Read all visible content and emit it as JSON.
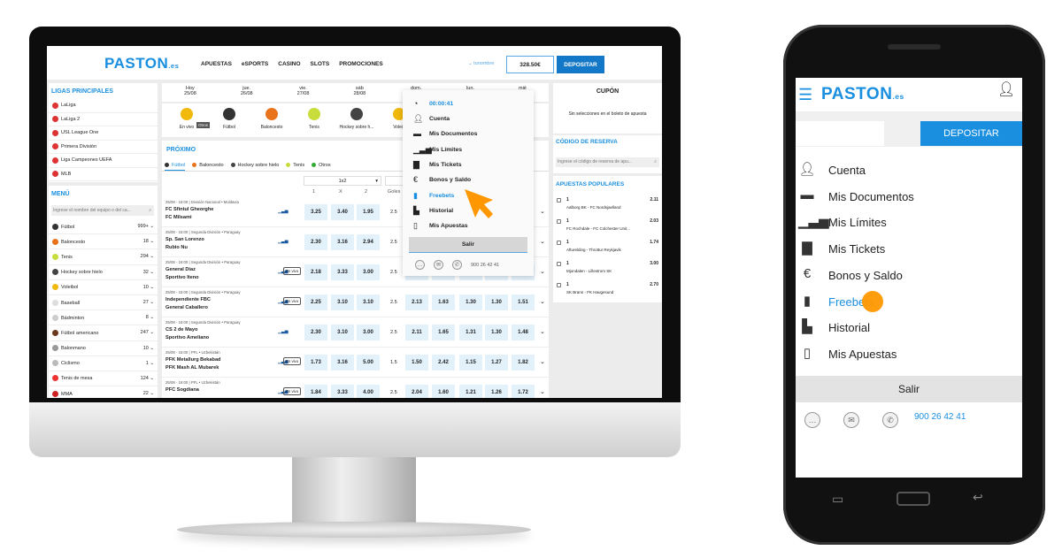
{
  "colors": {
    "brand": "#1a8fe0",
    "deposit": "#1478c8",
    "cursor": "#ff9800",
    "odds_bg": "#e3f1fb"
  },
  "desktop": {
    "logo": {
      "text": "PASTON",
      "suffix": ".es"
    },
    "nav": [
      "APUESTAS",
      "eSPORTS",
      "CASINO",
      "SLOTS",
      "PROMOCIONES"
    ],
    "user": "tunombre",
    "balance": "328.50€",
    "deposit": "DEPOSITAR",
    "leagues_title": "LIGAS PRINCIPALES",
    "leagues": [
      "LaLiga",
      "LaLiga 2",
      "USL League One",
      "Primera División",
      "Liga Campeones UEFA",
      "MLB"
    ],
    "menu_title": "MENÚ",
    "menu_search_placeholder": "Ingrese el nombre del equipo o del ca...",
    "sports": [
      {
        "name": "Fútbol",
        "count": "999+",
        "color": "#333"
      },
      {
        "name": "Baloncesto",
        "count": "18",
        "color": "#e8731a"
      },
      {
        "name": "Tenis",
        "count": "294",
        "color": "#c8dc3c"
      },
      {
        "name": "Hockey sobre hielo",
        "count": "32",
        "color": "#444"
      },
      {
        "name": "Voleibol",
        "count": "10",
        "color": "#f0b90b"
      },
      {
        "name": "Baseball",
        "count": "27",
        "color": "#ddd"
      },
      {
        "name": "Bádminton",
        "count": "8",
        "color": "#ccc"
      },
      {
        "name": "Fútbol americano",
        "count": "247",
        "color": "#6b3a1e"
      },
      {
        "name": "Balonmano",
        "count": "10",
        "color": "#999"
      },
      {
        "name": "Ciclismo",
        "count": "1",
        "color": "#bbb"
      },
      {
        "name": "Tenis de mesa",
        "count": "124",
        "color": "#e33"
      },
      {
        "name": "MMA",
        "count": "22",
        "color": "#c22"
      }
    ],
    "dates": [
      {
        "d": "Hoy",
        "n": "25/08"
      },
      {
        "d": "jue.",
        "n": "26/08"
      },
      {
        "d": "vie.",
        "n": "27/08"
      },
      {
        "d": "sáb",
        "n": "28/08"
      },
      {
        "d": "dom.",
        "n": "29/08"
      },
      {
        "d": "lun.",
        "n": ""
      },
      {
        "d": "mié",
        "n": ""
      }
    ],
    "sport_icons": [
      {
        "name": "En vivo",
        "color": "#f0b90b"
      },
      {
        "name": "Fútbol",
        "color": "#333"
      },
      {
        "name": "Baloncesto",
        "color": "#e8731a"
      },
      {
        "name": "Tenis",
        "color": "#c8dc3c"
      },
      {
        "name": "Hockey sobre h...",
        "color": "#444"
      },
      {
        "name": "Voleib",
        "color": "#f0b90b"
      }
    ],
    "tooltip": "Otros",
    "upcoming_title": "PRÓXIMO",
    "upcoming_tabs": [
      "Fútbol",
      "Baloncesto",
      "Hockey sobre hielo",
      "Tenis",
      "Otros"
    ],
    "market_select": "1x2",
    "col_headers": [
      "1",
      "X",
      "2",
      "Goles"
    ],
    "live_label": "En vivo",
    "matches": [
      {
        "meta": "25/08 - 16:00 | División Nacional • Moldavia",
        "home": "FC Sfintul Gheorghe",
        "away": "FC Milsami",
        "live": false,
        "odds": [
          "3.25",
          "3.40",
          "1.95"
        ],
        "goals": "2.5",
        "extra": []
      },
      {
        "meta": "25/08 - 16:00 | Segunda División • Paraguay",
        "home": "Sp. San Lorenzo",
        "away": "Rubio Nu",
        "live": false,
        "odds": [
          "2.30",
          "3.16",
          "2.94"
        ],
        "goals": "2.5",
        "extra": []
      },
      {
        "meta": "25/08 - 16:00 | Segunda División • Paraguay",
        "home": "General Díaz",
        "away": "Sportivo Iteno",
        "live": true,
        "odds": [
          "2.18",
          "3.33",
          "3.00"
        ],
        "goals": "2.5",
        "extra": [
          "2.28",
          "1.55",
          "1.32",
          "1.26",
          "1.53"
        ]
      },
      {
        "meta": "25/08 - 16:00 | Segunda División • Paraguay",
        "home": "Independiente FBC",
        "away": "General Caballero",
        "live": true,
        "odds": [
          "2.25",
          "3.10",
          "3.10"
        ],
        "goals": "2.5",
        "extra": [
          "2.13",
          "1.63",
          "1.30",
          "1.30",
          "1.51"
        ]
      },
      {
        "meta": "25/08 - 16:00 | Segunda División • Paraguay",
        "home": "CS 2 de Mayo",
        "away": "Sportivo Ameliano",
        "live": false,
        "odds": [
          "2.30",
          "3.10",
          "3.00"
        ],
        "goals": "2.5",
        "extra": [
          "2.11",
          "1.65",
          "1.31",
          "1.30",
          "1.48"
        ]
      },
      {
        "meta": "25/08 - 16:00 | PFL • Uzbekistán",
        "home": "PFK Metallurg Bekabad",
        "away": "PFK Mash AL Mubarek",
        "live": true,
        "odds": [
          "1.73",
          "3.16",
          "5.00"
        ],
        "goals": "1.5",
        "extra": [
          "1.50",
          "2.42",
          "1.15",
          "1.27",
          "1.82"
        ]
      },
      {
        "meta": "25/08 - 16:00 | PFL • Uzbekistán",
        "home": "PFC Sogdiana",
        "away": "",
        "live": true,
        "odds": [
          "1.84",
          "3.33",
          "4.00"
        ],
        "goals": "2.5",
        "extra": [
          "2.04",
          "1.60",
          "1.21",
          "1.26",
          "1.72"
        ]
      }
    ],
    "dropdown": {
      "timer": "00:00:41",
      "items": [
        "Cuenta",
        "Mis Documentos",
        "Mis Límites",
        "Mis Tickets",
        "Bonos y Saldo",
        "Freebets",
        "Historial",
        "Mis Apuestas"
      ],
      "logout": "Salir",
      "phone": "900 26 42 41"
    },
    "coupon_title": "CUPÓN",
    "coupon_empty": "Sin selecciones en el boleto de apuesta",
    "reserve_title": "CÓDIGO DE RESERVA",
    "reserve_placeholder": "Ingrese el código de reserva de apu...",
    "popular_title": "APUESTAS POPULARES",
    "popular": [
      {
        "pick": "1",
        "match": "Aalborg BK - FC Nordsjaelland",
        "odd": "2.11"
      },
      {
        "pick": "1",
        "match": "FC Rochdale - FC Colchester Unit...",
        "odd": "2.03"
      },
      {
        "pick": "1",
        "match": "Afturelding - Throttur Reykjavik",
        "odd": "1.74"
      },
      {
        "pick": "1",
        "match": "Mjondalen - Lillestrom SK",
        "odd": "3.00"
      },
      {
        "pick": "1",
        "match": "SK Brann - FK Haugesund",
        "odd": "2.70"
      }
    ]
  },
  "mobile": {
    "logo": {
      "text": "PASTON",
      "suffix": ".es"
    },
    "deposit": "DEPOSITAR",
    "items": [
      "Cuenta",
      "Mis Documentos",
      "Mis Límites",
      "Mis Tickets",
      "Bonos y Saldo",
      "Freebets",
      "Historial",
      "Mis Apuestas"
    ],
    "active_item": "Freebets",
    "logout": "Salir",
    "phone": "900 26 42 41"
  }
}
